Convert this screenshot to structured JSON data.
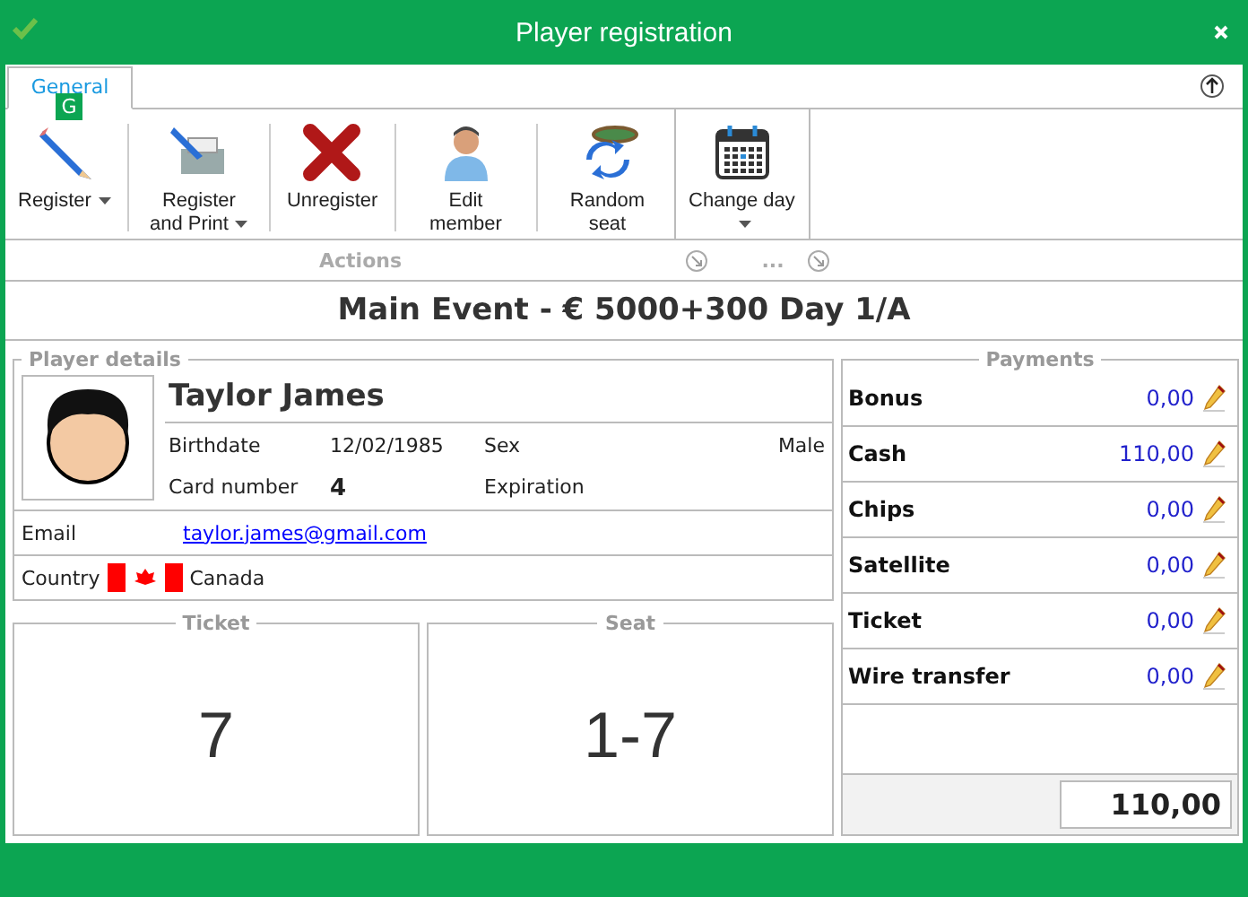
{
  "window": {
    "title": "Player registration"
  },
  "ribbon": {
    "tabs": [
      {
        "label": "General",
        "selected": true,
        "key_tip": "G"
      }
    ],
    "groups": [
      {
        "label": "Actions",
        "buttons": [
          {
            "label": "Register",
            "kind": "pencil",
            "dropdown": true
          },
          {
            "label": "Register and Print",
            "kind": "printer",
            "dropdown": true
          },
          {
            "label": "Unregister",
            "kind": "cross",
            "dropdown": false
          },
          {
            "label": "Edit member",
            "kind": "person",
            "dropdown": false
          },
          {
            "label": "Random seat",
            "kind": "table",
            "dropdown": false
          }
        ]
      },
      {
        "label": "...",
        "buttons": [
          {
            "label": "Change day",
            "kind": "calendar",
            "dropdown": true
          }
        ]
      }
    ]
  },
  "event_title": "Main Event - € 5000+300 Day 1/A",
  "player_details": {
    "title": "Player details",
    "name": "Taylor James",
    "fields": [
      {
        "label": "Birthdate",
        "value": "12/02/1985"
      },
      {
        "label": "Sex",
        "value": "Male"
      },
      {
        "label": "Card number",
        "value": "4"
      },
      {
        "label": "Expiration"
      }
    ],
    "email_label": "Email",
    "email": "taylor.james@gmail.com",
    "country_label": "Country",
    "country": "Canada"
  },
  "ticket": {
    "title": "Ticket",
    "value": "7"
  },
  "seat": {
    "title": "Seat",
    "value": "1-7"
  },
  "payments": {
    "title": "Payments",
    "items": [
      {
        "label": "Bonus",
        "amount": "0,00"
      },
      {
        "label": "Cash",
        "amount": "110,00"
      },
      {
        "label": "Chips",
        "amount": "0,00"
      },
      {
        "label": "Satellite",
        "amount": "0,00"
      },
      {
        "label": "Ticket",
        "amount": "0,00"
      },
      {
        "label": "Wire transfer",
        "amount": "0,00"
      }
    ],
    "total": "110,00"
  }
}
